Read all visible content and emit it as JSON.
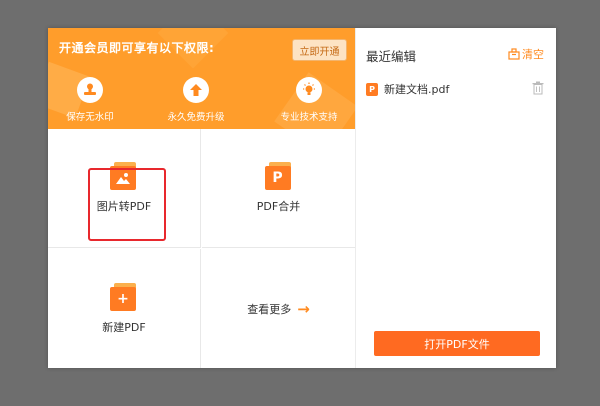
{
  "banner": {
    "title": "开通会员即可享有以下权限:",
    "open_button": "立即开通",
    "perks": [
      {
        "label": "保存无水印",
        "icon": "stamp-icon"
      },
      {
        "label": "永久免费升级",
        "icon": "upgrade-arrow-icon"
      },
      {
        "label": "专业技术支持",
        "icon": "lightbulb-icon"
      }
    ]
  },
  "tools": [
    {
      "label": "图片转PDF",
      "icon": "image-file-icon"
    },
    {
      "label": "PDF合并",
      "icon": "pdf-file-icon",
      "glyph": "P"
    },
    {
      "label": "新建PDF",
      "icon": "new-file-plus-icon",
      "glyph": "+"
    },
    {
      "label": "查看更多",
      "icon": "arrow-right-icon",
      "glyph": "→"
    }
  ],
  "recent": {
    "title": "最近编辑",
    "clear_label": "清空",
    "items": [
      {
        "name": "新建文档.pdf",
        "icon_glyph": "P"
      }
    ],
    "open_button": "打开PDF文件"
  },
  "colors": {
    "accent": "#ff9d2b",
    "button": "#ff6a21",
    "highlight_border": "#e8282d"
  }
}
